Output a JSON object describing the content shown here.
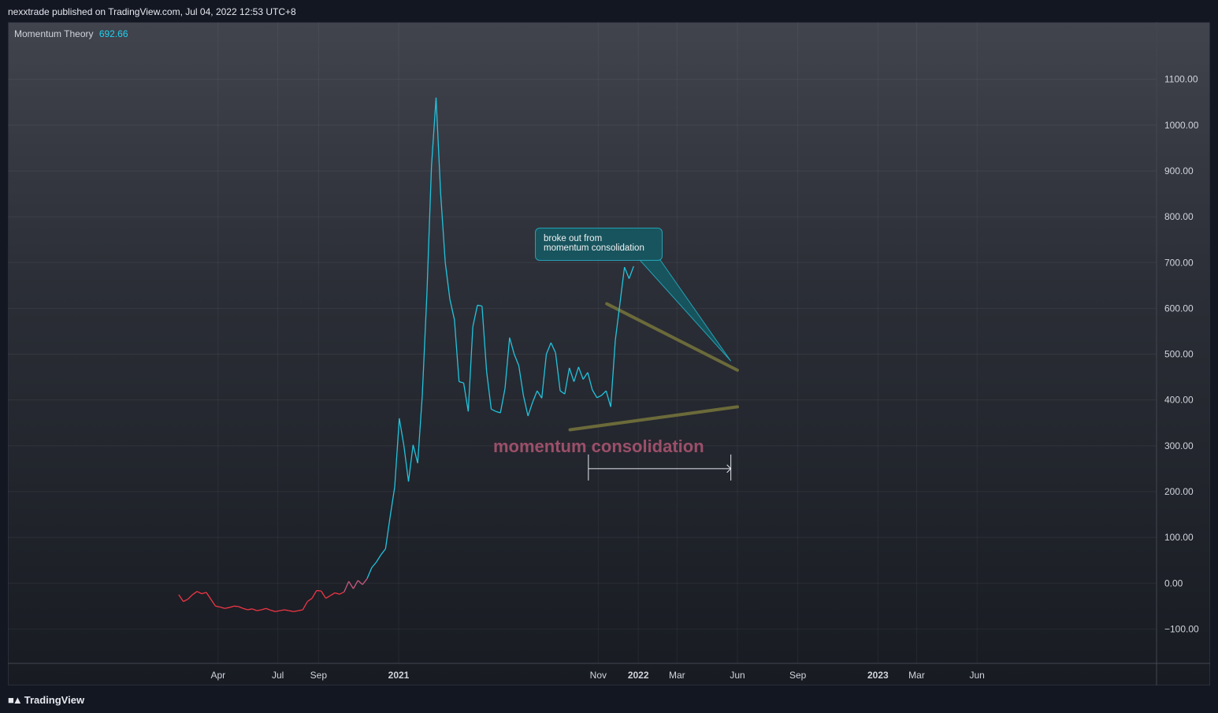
{
  "header": {
    "published": "nexxtrade published on TradingView.com, Jul 04, 2022 12:53 UTC+8"
  },
  "indicator": {
    "name": "Momentum Theory",
    "value": "692.66"
  },
  "annotations": {
    "callout_line1": "broke out from",
    "callout_line2": "momentum consolidation",
    "consolidation_label": "momentum consolidation"
  },
  "footer": {
    "brand": "TradingView"
  },
  "colors": {
    "background_top": "#41434d",
    "background_bottom": "#181b22",
    "positive_line": "#22c3dd",
    "negative_line": "#f23645",
    "trendline": "#6b6a3a",
    "callout_fill": "#145a64",
    "consolidation_label": "#9c4f69"
  },
  "chart_data": {
    "type": "line",
    "title": "Momentum Theory",
    "x_axis_type": "weekly",
    "x_start": "2020-02-01",
    "x_ticks": [
      {
        "date": "2020-04-01",
        "label": "Apr",
        "bold": false
      },
      {
        "date": "2020-07-01",
        "label": "Jul",
        "bold": false
      },
      {
        "date": "2020-09-01",
        "label": "Sep",
        "bold": false
      },
      {
        "date": "2021-01-01",
        "label": "2021",
        "bold": true
      },
      {
        "date": "2021-11-01",
        "label": "Nov",
        "bold": false
      },
      {
        "date": "2022-01-01",
        "label": "2022",
        "bold": true
      },
      {
        "date": "2022-03-01",
        "label": "Mar",
        "bold": false
      },
      {
        "date": "2022-06-01",
        "label": "Jun",
        "bold": false
      },
      {
        "date": "2022-09-01",
        "label": "Sep",
        "bold": false
      },
      {
        "date": "2023-01-01",
        "label": "2023",
        "bold": true
      },
      {
        "date": "2023-03-01",
        "label": "Mar",
        "bold": false
      },
      {
        "date": "2023-06-01",
        "label": "Jun",
        "bold": false
      }
    ],
    "y_ticks": [
      1100,
      1000,
      900,
      800,
      700,
      600,
      500,
      400,
      300,
      200,
      100,
      0,
      -100
    ],
    "y_tick_labels": [
      "1100.00",
      "1000.00",
      "900.00",
      "800.00",
      "700.00",
      "600.00",
      "500.00",
      "400.00",
      "300.00",
      "200.00",
      "100.00",
      "0.00",
      "−100.00"
    ],
    "ylim": [
      -175,
      1225
    ],
    "grid": true,
    "series": [
      {
        "name": "Momentum Theory",
        "values": [
          -25,
          -40,
          -35,
          -25,
          -18,
          -23,
          -20,
          -35,
          -50,
          -52,
          -55,
          -53,
          -50,
          -51,
          -55,
          -58,
          -56,
          -60,
          -58,
          -55,
          -59,
          -62,
          -60,
          -58,
          -60,
          -62,
          -60,
          -58,
          -40,
          -33,
          -16,
          -17,
          -33,
          -27,
          -21,
          -24,
          -19,
          4,
          -12,
          6,
          -3,
          10,
          34,
          46,
          62,
          75,
          145,
          210,
          360,
          300,
          222,
          302,
          262,
          410,
          630,
          910,
          1060,
          850,
          700,
          620,
          575,
          440,
          437,
          375,
          560,
          607,
          605,
          462,
          380,
          375,
          372,
          425,
          536,
          500,
          475,
          410,
          365,
          395,
          420,
          404,
          500,
          525,
          503,
          420,
          413,
          470,
          440,
          472,
          445,
          460,
          422,
          405,
          410,
          420,
          385,
          530,
          610,
          690,
          665,
          692
        ]
      }
    ],
    "trendlines": [
      {
        "x1": "2021-11-14",
        "y1": 610,
        "x2": "2022-06-01",
        "y2": 465
      },
      {
        "x1": "2021-09-19",
        "y1": 335,
        "x2": "2022-06-01",
        "y2": 385
      }
    ],
    "range_marker": {
      "x_start": "2021-10-17",
      "x_end": "2022-05-22",
      "y": 250
    },
    "callout_target": {
      "x": "2022-05-22",
      "y": 485
    }
  }
}
